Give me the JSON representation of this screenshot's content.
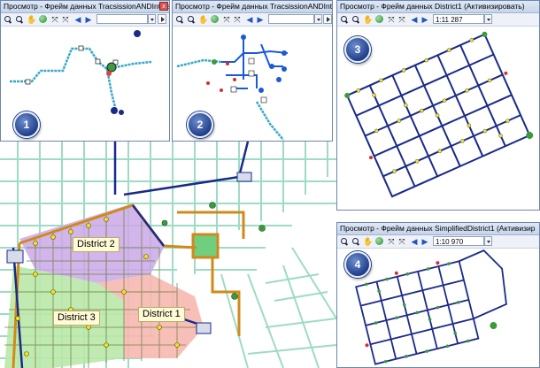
{
  "windows": {
    "w1": {
      "title": "Просмотр - Фрейм данных TracsissionANDIntmal",
      "close": "x",
      "badge": "1"
    },
    "w2": {
      "title": "Просмотр - Фрейм данных TracsissionANDIntrr",
      "badge": "2"
    },
    "w3": {
      "title": "Просмотр - Фрейм данных  District1   (Активизировать)",
      "scale": "1:11 287",
      "badge": "3"
    },
    "w4": {
      "title": "Просмотр - Фрейм данных SimplifiedDistrict1 (Активизир",
      "scale": "1:10 970",
      "badge": "4"
    }
  },
  "toolbar": {
    "zoom_in": "+",
    "zoom_out": "−",
    "pan": "✋",
    "full_extent": "⤧",
    "back": "◀"
  },
  "main_map": {
    "district_labels": [
      "District 2",
      "District 3",
      "District 1"
    ]
  },
  "colors": {
    "title_bar": "#c6d4ea",
    "district2": "#c9a8e6",
    "district3": "#b8e6a8",
    "district1": "#f4b6b0",
    "street_grid": "#a8e0c8",
    "pipe": "#1a2a8a",
    "pipe_orange": "#d08a1a"
  }
}
